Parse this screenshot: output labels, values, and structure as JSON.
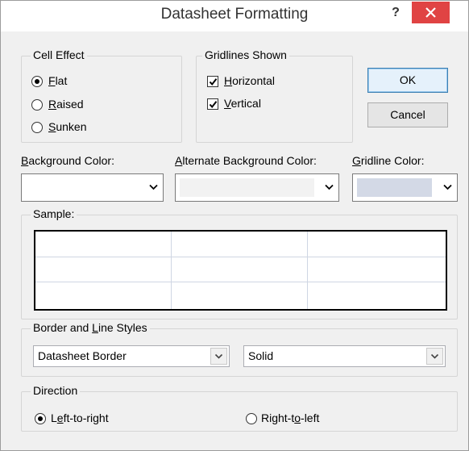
{
  "window": {
    "title": "Datasheet Formatting",
    "help_glyph": "?",
    "close_glyph": "×"
  },
  "cell_effect": {
    "legend": "Cell Effect",
    "options": [
      {
        "label": "Flat",
        "checked": true
      },
      {
        "label": "Raised",
        "checked": false
      },
      {
        "label": "Sunken",
        "checked": false
      }
    ]
  },
  "gridlines": {
    "legend": "Gridlines Shown",
    "options": [
      {
        "label": "Horizontal",
        "checked": true
      },
      {
        "label": "Vertical",
        "checked": true
      }
    ]
  },
  "buttons": {
    "ok": "OK",
    "cancel": "Cancel"
  },
  "colors": {
    "background_label": "Background Color:",
    "background_value": "#ffffff",
    "alternate_label": "Alternate Background Color:",
    "alternate_value": "#f2f2f2",
    "gridline_label": "Gridline Color:",
    "gridline_value": "#d3d9e6"
  },
  "sample": {
    "legend": "Sample:",
    "columns": 3,
    "rows": 3
  },
  "border_styles": {
    "legend": "Border and Line Styles",
    "border_select": "Datasheet Border",
    "line_select": "Solid"
  },
  "direction": {
    "legend": "Direction",
    "options": [
      {
        "label": "Left-to-right",
        "checked": true
      },
      {
        "label": "Right-to-left",
        "checked": false
      }
    ]
  }
}
